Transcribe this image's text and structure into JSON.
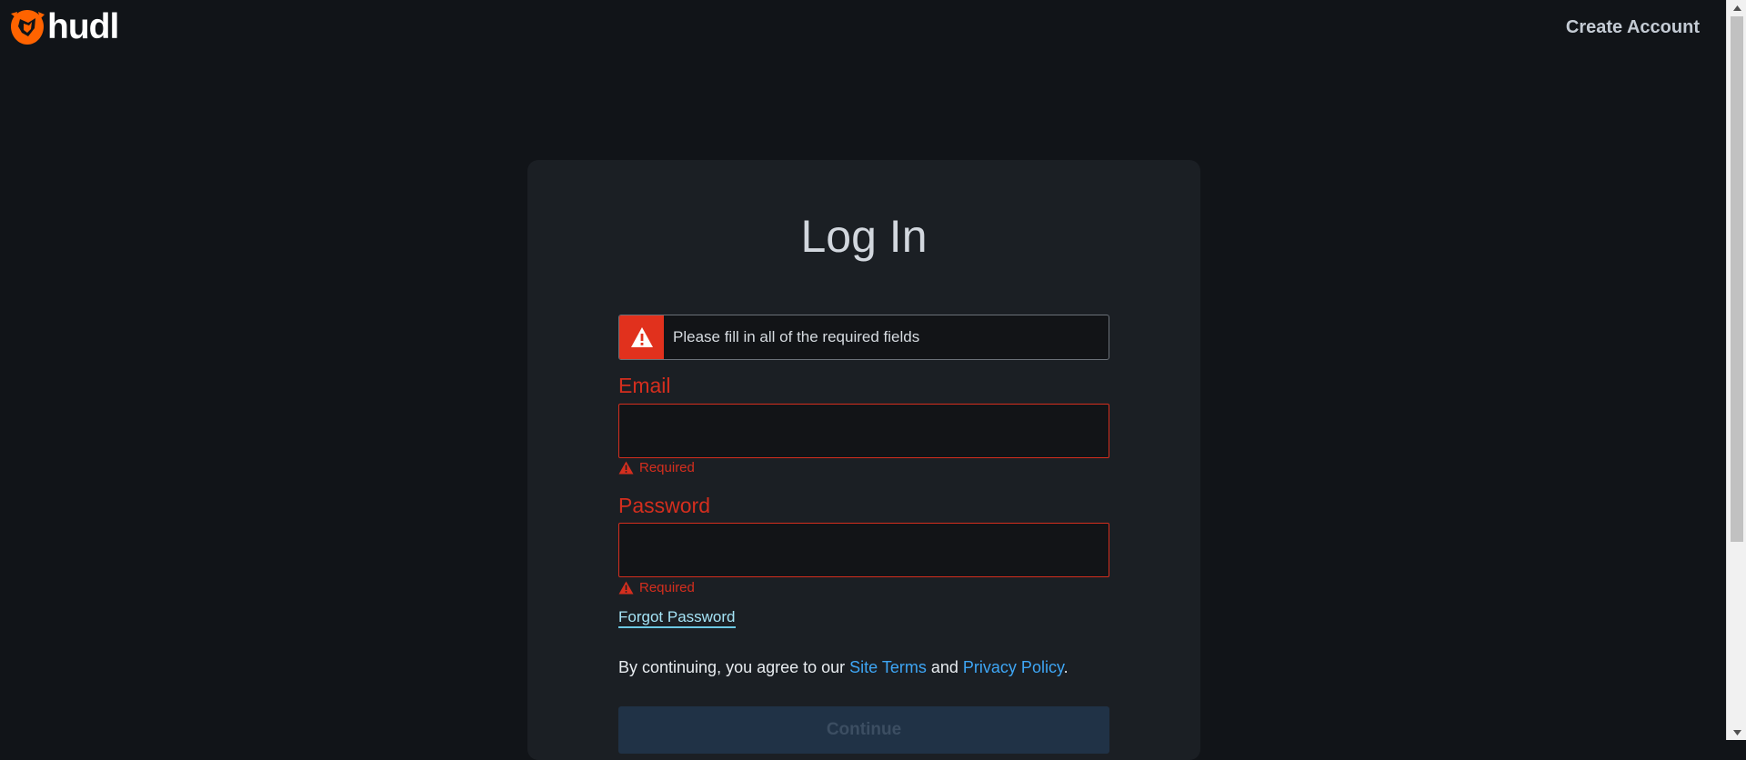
{
  "brand": {
    "name": "hudl",
    "accent_color": "#ff6300",
    "logo_icon": "hudl-logo-icon"
  },
  "header": {
    "create_account_label": "Create Account"
  },
  "login": {
    "title": "Log In",
    "alert": {
      "icon": "warning-icon",
      "message": "Please fill in all of the required fields",
      "color": "#e1311d"
    },
    "email": {
      "label": "Email",
      "value": "",
      "help_text": "Required"
    },
    "password": {
      "label": "Password",
      "value": "",
      "help_text": "Required"
    },
    "forgot_password_label": "Forgot Password",
    "terms": {
      "prefix": "By continuing, you agree to our ",
      "site_terms_label": "Site Terms",
      "middle": " and ",
      "privacy_policy_label": "Privacy Policy",
      "suffix": "."
    },
    "continue_label": "Continue"
  },
  "error_color": "#d42e1e",
  "link_color": "#3ea6f5"
}
